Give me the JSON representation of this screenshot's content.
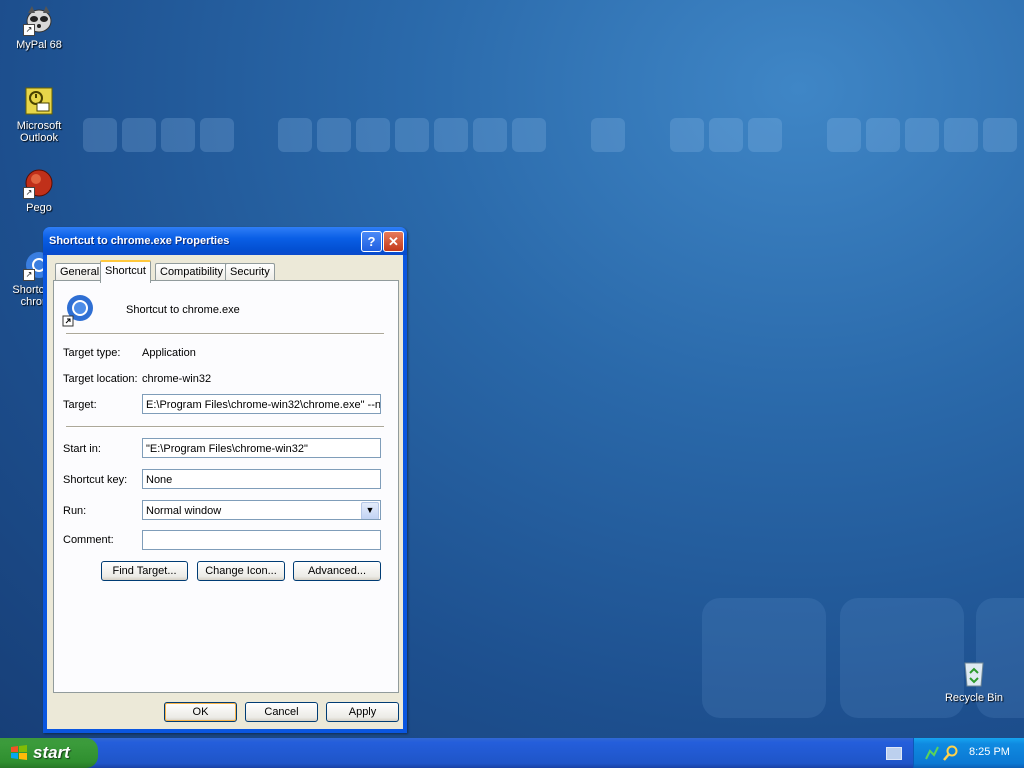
{
  "desktop": {
    "icons": [
      {
        "label": "MyPal 68"
      },
      {
        "label": "Microsoft Outlook"
      },
      {
        "label": "Pego"
      },
      {
        "label": "Shortcut to chrome"
      },
      {
        "label": "Recycle Bin"
      }
    ],
    "shortcut_arrow": "↗"
  },
  "dialog": {
    "title": "Shortcut to chrome.exe Properties",
    "help_glyph": "?",
    "close_glyph": "✕",
    "tabs": [
      {
        "label": "General"
      },
      {
        "label": "Shortcut",
        "active": true
      },
      {
        "label": "Compatibility"
      },
      {
        "label": "Security"
      }
    ],
    "shortcut_name": "Shortcut to chrome.exe",
    "fields": {
      "target_type_label": "Target type:",
      "target_type_value": "Application",
      "target_location_label": "Target location:",
      "target_location_value": "chrome-win32",
      "target_label": "Target:",
      "target_value": "E:\\Program Files\\chrome-win32\\chrome.exe\" --n",
      "start_in_label": "Start in:",
      "start_in_value": "\"E:\\Program Files\\chrome-win32\"",
      "shortcut_key_label": "Shortcut key:",
      "shortcut_key_value": "None",
      "run_label": "Run:",
      "run_value": "Normal window",
      "comment_label": "Comment:",
      "comment_value": ""
    },
    "buttons": {
      "find_target": "Find Target...",
      "change_icon": "Change Icon...",
      "advanced": "Advanced...",
      "ok": "OK",
      "cancel": "Cancel",
      "apply": "Apply"
    }
  },
  "taskbar": {
    "start_label": "start",
    "clock": "8:25 PM"
  },
  "colors": {
    "xp_blue": "#0a56e0",
    "start_green": "#3c9a3c",
    "dialog_face": "#ece9d8"
  }
}
